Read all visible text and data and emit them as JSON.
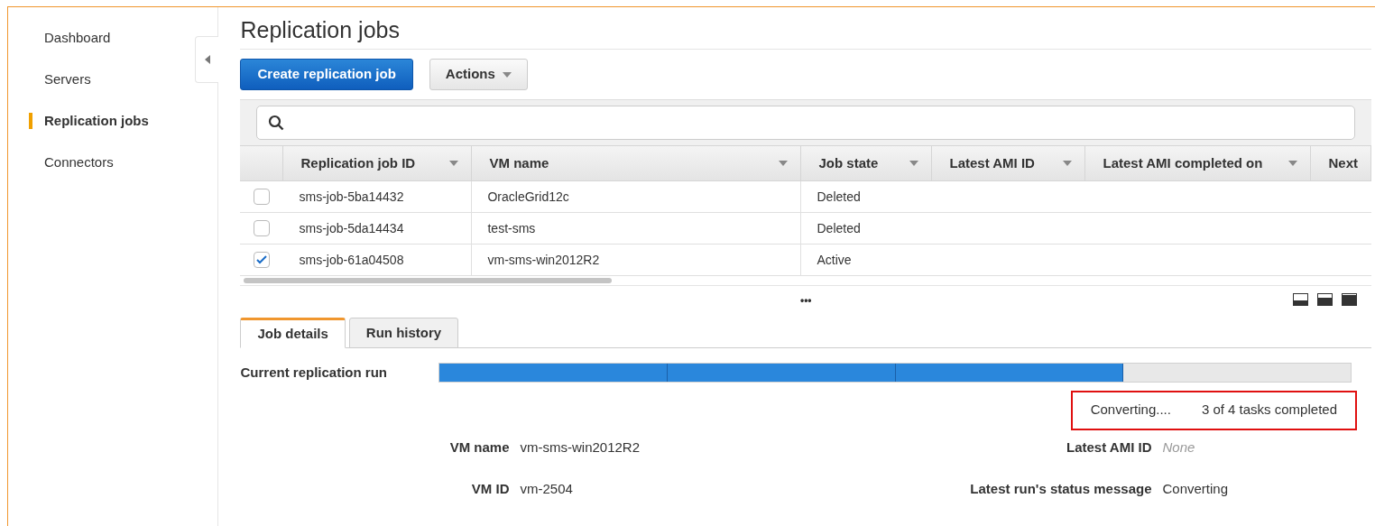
{
  "sidebar": {
    "items": [
      {
        "label": "Dashboard",
        "selected": false
      },
      {
        "label": "Servers",
        "selected": false
      },
      {
        "label": "Replication jobs",
        "selected": true
      },
      {
        "label": "Connectors",
        "selected": false
      }
    ]
  },
  "page": {
    "title": "Replication jobs",
    "primary_button": "Create replication job",
    "actions_button": "Actions"
  },
  "table": {
    "columns": [
      "Replication job ID",
      "VM name",
      "Job state",
      "Latest AMI ID",
      "Latest AMI completed on",
      "Next"
    ],
    "rows": [
      {
        "checked": false,
        "cells": [
          "sms-job-5ba14432",
          "OracleGrid12c",
          "Deleted"
        ]
      },
      {
        "checked": false,
        "cells": [
          "sms-job-5da14434",
          "test-sms",
          "Deleted"
        ]
      },
      {
        "checked": true,
        "cells": [
          "sms-job-61a04508",
          "vm-sms-win2012R2",
          "Active"
        ]
      }
    ]
  },
  "splitter": "•••",
  "tabs": [
    {
      "label": "Job details",
      "selected": true
    },
    {
      "label": "Run history",
      "selected": false
    }
  ],
  "run": {
    "label": "Current replication run",
    "segments": [
      {
        "done": true
      },
      {
        "done": true
      },
      {
        "done": true
      },
      {
        "done": false
      }
    ],
    "status": "Converting....",
    "tasks": "3 of 4 tasks completed"
  },
  "details": [
    {
      "label": "VM name",
      "value": "vm-sms-win2012R2",
      "empty": false
    },
    {
      "label": "Latest AMI ID",
      "value": "None",
      "empty": true
    },
    {
      "label": "VM ID",
      "value": "vm-2504",
      "empty": false
    },
    {
      "label": "Latest run's status message",
      "value": "Converting",
      "empty": false
    }
  ]
}
